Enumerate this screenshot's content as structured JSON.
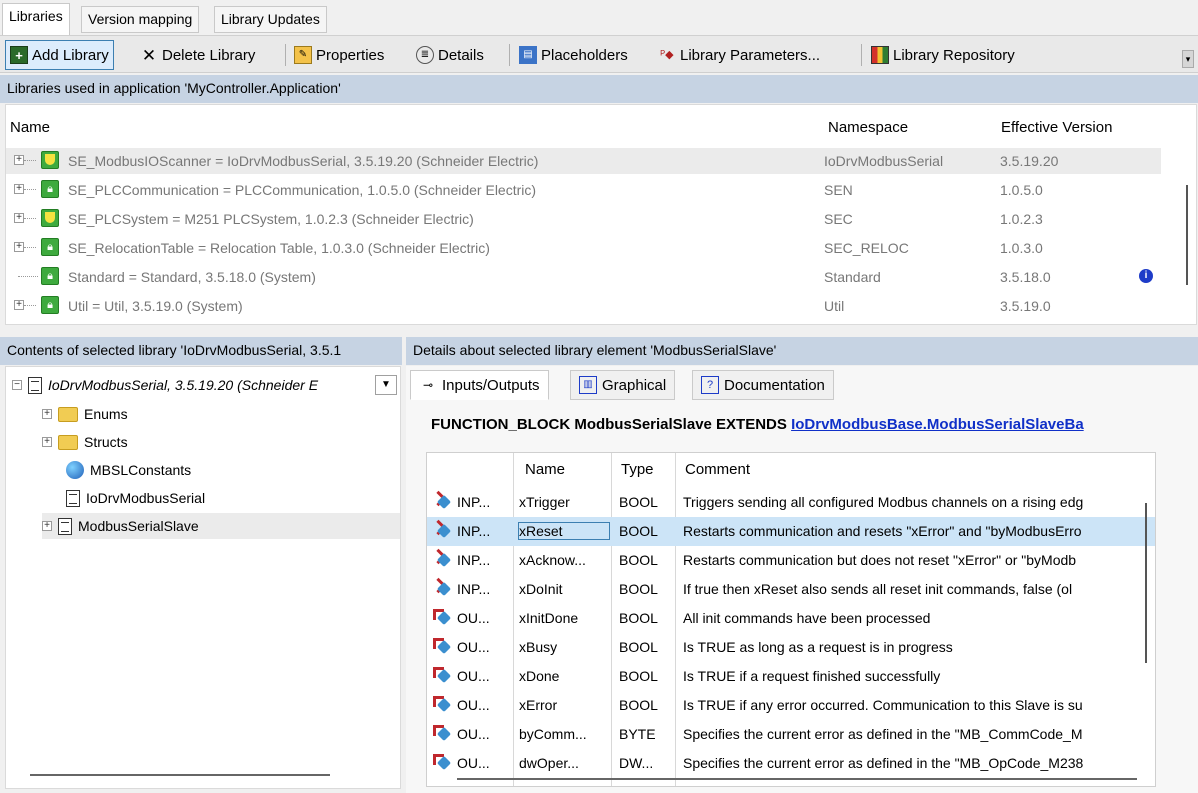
{
  "tabs": [
    "Libraries",
    "Version mapping",
    "Library Updates"
  ],
  "toolbar": {
    "add_library": "Add Library",
    "delete_library": "Delete Library",
    "properties": "Properties",
    "details": "Details",
    "placeholders": "Placeholders",
    "library_parameters": "Library Parameters...",
    "library_repository": "Library Repository"
  },
  "libraries_header": "Libraries used in application 'MyController.Application'",
  "lib_columns": {
    "name": "Name",
    "namespace": "Namespace",
    "version": "Effective Version"
  },
  "libraries": [
    {
      "name": "SE_ModbusIOScanner = IoDrvModbusSerial, 3.5.19.20 (Schneider Electric)",
      "namespace": "IoDrvModbusSerial",
      "version": "3.5.19.20"
    },
    {
      "name": "SE_PLCCommunication = PLCCommunication, 1.0.5.0 (Schneider Electric)",
      "namespace": "SEN",
      "version": "1.0.5.0"
    },
    {
      "name": "SE_PLCSystem = M251 PLCSystem, 1.0.2.3 (Schneider Electric)",
      "namespace": "SEC",
      "version": "1.0.2.3"
    },
    {
      "name": "SE_RelocationTable = Relocation Table, 1.0.3.0 (Schneider Electric)",
      "namespace": "SEC_RELOC",
      "version": "1.0.3.0"
    },
    {
      "name": "Standard = Standard, 3.5.18.0 (System)",
      "namespace": "Standard",
      "version": "3.5.18.0"
    },
    {
      "name": "Util = Util, 3.5.19.0 (System)",
      "namespace": "Util",
      "version": "3.5.19.0"
    }
  ],
  "contents_header": "Contents of selected library 'IoDrvModbusSerial, 3.5.1",
  "details_header": "Details about selected library element 'ModbusSerialSlave'",
  "tree": {
    "root": "IoDrvModbusSerial, 3.5.19.20 (Schneider E",
    "items": [
      "Enums",
      "Structs",
      "MBSLConstants",
      "IoDrvModbusSerial",
      "ModbusSerialSlave"
    ]
  },
  "detail_tabs": [
    "Inputs/Outputs",
    "Graphical",
    "Documentation"
  ],
  "fb": {
    "prefix": "FUNCTION_BLOCK ModbusSerialSlave EXTENDS",
    "link": "IoDrvModbusBase.ModbusSerialSlaveBa"
  },
  "io_columns": {
    "name": "Name",
    "type": "Type",
    "comment": "Comment"
  },
  "io_rows": [
    {
      "kind": "INP...",
      "name": "xTrigger",
      "type": "BOOL",
      "comment": "Triggers sending all configured Modbus channels on a rising edg"
    },
    {
      "kind": "INP...",
      "name": "xReset",
      "type": "BOOL",
      "comment": "Restarts communication and resets \"xError\" and \"byModbusErro"
    },
    {
      "kind": "INP...",
      "name": "xAcknow...",
      "type": "BOOL",
      "comment": "Restarts communication but does not reset \"xError\" or \"byModb"
    },
    {
      "kind": "INP...",
      "name": "xDoInit",
      "type": "BOOL",
      "comment": "If true then xReset also sends all reset init commands, false (ol"
    },
    {
      "kind": "OU...",
      "name": "xInitDone",
      "type": "BOOL",
      "comment": "All init commands have been processed"
    },
    {
      "kind": "OU...",
      "name": "xBusy",
      "type": "BOOL",
      "comment": "Is TRUE as long as a request is in progress"
    },
    {
      "kind": "OU...",
      "name": "xDone",
      "type": "BOOL",
      "comment": "Is TRUE if a request finished successfully"
    },
    {
      "kind": "OU...",
      "name": "xError",
      "type": "BOOL",
      "comment": "Is TRUE if any error occurred. Communication to this Slave is su"
    },
    {
      "kind": "OU...",
      "name": "byComm...",
      "type": "BYTE",
      "comment": "Specifies the current error as defined in the \"MB_CommCode_M"
    },
    {
      "kind": "OU...",
      "name": "dwOper...",
      "type": "DW...",
      "comment": "Specifies the current error as defined in the \"MB_OpCode_M238"
    }
  ]
}
